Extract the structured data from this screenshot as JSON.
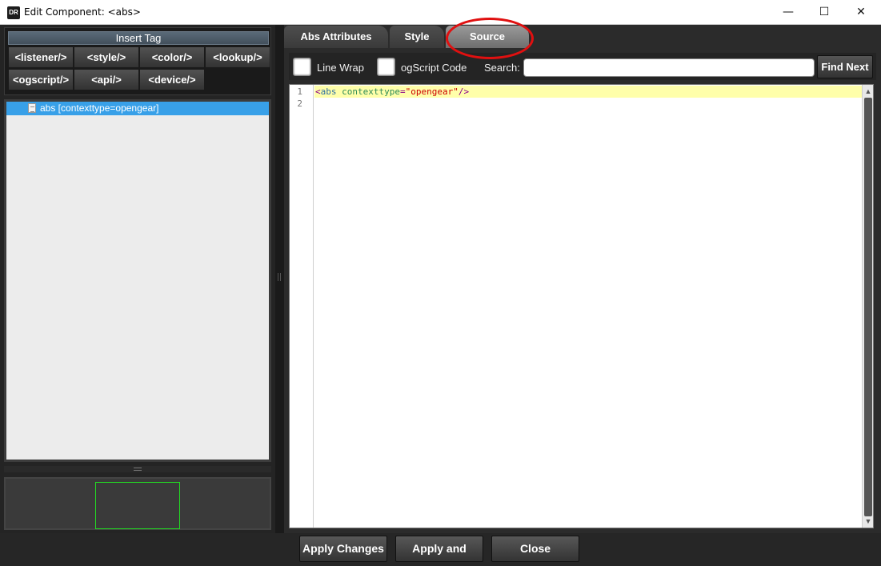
{
  "window": {
    "app_icon_text": "DR",
    "title": "Edit Component: <abs>",
    "minimize": "—",
    "maximize": "☐",
    "close": "✕"
  },
  "insert_tag": {
    "header": "Insert Tag",
    "buttons": [
      "<listener/>",
      "<style/>",
      "<color/>",
      "<lookup/>",
      "<ogscript/>",
      "<api/>",
      "<device/>"
    ]
  },
  "tree": {
    "items": [
      {
        "label": "abs [contexttype=opengear]",
        "selected": true
      }
    ]
  },
  "tabs": {
    "items": [
      "Abs Attributes",
      "Style",
      "Source"
    ],
    "active": "Source"
  },
  "toolbar": {
    "line_wrap_label": "Line Wrap",
    "line_wrap_checked": false,
    "ogscript_label": "ogScript Code",
    "ogscript_checked": false,
    "search_label": "Search:",
    "search_value": "",
    "find_next_label": "Find Next"
  },
  "editor": {
    "line_numbers": [
      "1",
      "2"
    ],
    "code": {
      "open": "<",
      "tag": "abs",
      "space": " ",
      "attr": "contexttype",
      "eq": "=",
      "value": "\"opengear\"",
      "close": "/>"
    }
  },
  "bottom": {
    "apply_changes": "Apply Changes",
    "apply_and_close": "Apply and Close",
    "close": "Close"
  },
  "colors": {
    "accent_selection": "#38a0e8",
    "annotation": "#e01010",
    "current_line": "#ffffaa",
    "preview_border": "#22dd22"
  },
  "icons": {
    "tree_item": "document-icon",
    "scroll_up": "scroll-up-arrow-icon",
    "scroll_down": "scroll-down-arrow-icon"
  }
}
